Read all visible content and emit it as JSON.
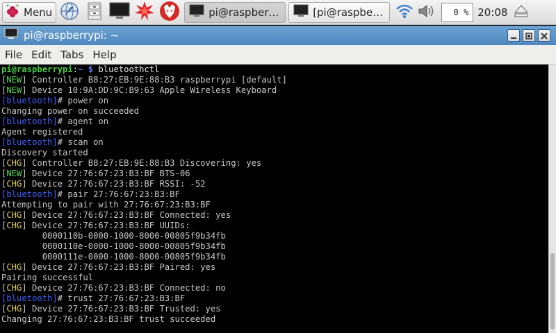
{
  "panel": {
    "menu_label": "Menu",
    "launchers": [
      "web-browser-icon",
      "file-manager-icon",
      "terminal-icon",
      "mathematica-icon",
      "wolfram-icon"
    ],
    "tasks": [
      {
        "label": "pi@raspberry...",
        "state": "active"
      },
      {
        "label": "[pi@raspberry...",
        "state": "inactive"
      }
    ],
    "cpu": "0 %",
    "clock": "20:08"
  },
  "window": {
    "title": "pi@raspberrypi: ~"
  },
  "menubar": [
    "File",
    "Edit",
    "Tabs",
    "Help"
  ],
  "terminal": {
    "lines": [
      [
        {
          "t": "pi@raspberrypi",
          "c": "c-grn"
        },
        {
          "t": ":",
          "c": "c-wht"
        },
        {
          "t": "~ $",
          "c": "c-blu"
        },
        {
          "t": " bluetoothctl",
          "c": "c-wht"
        }
      ],
      [
        {
          "t": "[",
          "c": ""
        },
        {
          "t": "NEW",
          "c": "c-new"
        },
        {
          "t": "] Controller B8:27:EB:9E:88:B3 raspberrypi [default]",
          "c": ""
        }
      ],
      [
        {
          "t": "[",
          "c": ""
        },
        {
          "t": "NEW",
          "c": "c-new"
        },
        {
          "t": "] Device 10:9A:DD:9C:B9:63 Apple Wireless Keyboard",
          "c": ""
        }
      ],
      [
        {
          "t": "[bluetooth]",
          "c": "c-bt"
        },
        {
          "t": "# power on",
          "c": ""
        }
      ],
      [
        {
          "t": "Changing power on succeeded",
          "c": ""
        }
      ],
      [
        {
          "t": "[bluetooth]",
          "c": "c-bt"
        },
        {
          "t": "# agent on",
          "c": ""
        }
      ],
      [
        {
          "t": "Agent registered",
          "c": ""
        }
      ],
      [
        {
          "t": "[bluetooth]",
          "c": "c-bt"
        },
        {
          "t": "# scan on",
          "c": ""
        }
      ],
      [
        {
          "t": "Discovery started",
          "c": ""
        }
      ],
      [
        {
          "t": "[",
          "c": ""
        },
        {
          "t": "CHG",
          "c": "c-chg"
        },
        {
          "t": "] Controller B8:27:EB:9E:88:B3 Discovering: yes",
          "c": ""
        }
      ],
      [
        {
          "t": "[",
          "c": ""
        },
        {
          "t": "NEW",
          "c": "c-new"
        },
        {
          "t": "] Device 27:76:67:23:B3:BF BTS-06",
          "c": ""
        }
      ],
      [
        {
          "t": "[",
          "c": ""
        },
        {
          "t": "CHG",
          "c": "c-chg"
        },
        {
          "t": "] Device 27:76:67:23:B3:BF RSSI: -52",
          "c": ""
        }
      ],
      [
        {
          "t": "[bluetooth]",
          "c": "c-bt"
        },
        {
          "t": "# pair 27:76:67:23:B3:BF",
          "c": ""
        }
      ],
      [
        {
          "t": "Attempting to pair with 27:76:67:23:B3:BF",
          "c": ""
        }
      ],
      [
        {
          "t": "[",
          "c": ""
        },
        {
          "t": "CHG",
          "c": "c-chg"
        },
        {
          "t": "] Device 27:76:67:23:B3:BF Connected: yes",
          "c": ""
        }
      ],
      [
        {
          "t": "[",
          "c": ""
        },
        {
          "t": "CHG",
          "c": "c-chg"
        },
        {
          "t": "] Device 27:76:67:23:B3:BF UUIDs:",
          "c": ""
        }
      ],
      [
        {
          "t": "        0000110b-0000-1000-8000-00805f9b34fb",
          "c": ""
        }
      ],
      [
        {
          "t": "        0000110e-0000-1000-8000-00805f9b34fb",
          "c": ""
        }
      ],
      [
        {
          "t": "        0000111e-0000-1000-8000-00805f9b34fb",
          "c": ""
        }
      ],
      [
        {
          "t": "[",
          "c": ""
        },
        {
          "t": "CHG",
          "c": "c-chg"
        },
        {
          "t": "] Device 27:76:67:23:B3:BF Paired: yes",
          "c": ""
        }
      ],
      [
        {
          "t": "Pairing successful",
          "c": ""
        }
      ],
      [
        {
          "t": "[",
          "c": ""
        },
        {
          "t": "CHG",
          "c": "c-chg"
        },
        {
          "t": "] Device 27:76:67:23:B3:BF Connected: no",
          "c": ""
        }
      ],
      [
        {
          "t": "[bluetooth]",
          "c": "c-bt"
        },
        {
          "t": "# trust 27:76:67:23:B3:BF",
          "c": ""
        }
      ],
      [
        {
          "t": "[",
          "c": ""
        },
        {
          "t": "CHG",
          "c": "c-chg"
        },
        {
          "t": "] Device 27:76:67:23:B3:BF Trusted: yes",
          "c": ""
        }
      ],
      [
        {
          "t": "Changing 27:76:67:23:B3:BF trust succeeded",
          "c": ""
        }
      ]
    ]
  }
}
